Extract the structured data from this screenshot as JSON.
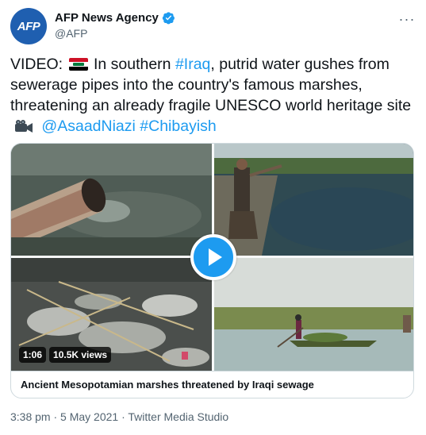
{
  "account": {
    "display_name": "AFP News Agency",
    "handle": "@AFP",
    "avatar_text": "AFP",
    "verified": true,
    "more_glyph": "···"
  },
  "tweet": {
    "lead": "VIDEO:",
    "text_1": "In southern",
    "hashtag_iraq": "#Iraq",
    "text_2": ", putrid water gushes from sewerage pipes into the country's famous marshes, threatening an already fragile UNESCO world heritage site",
    "mention": "@AsaadNiazi",
    "hashtag_chibayish": "#Chibayish"
  },
  "media": {
    "duration": "1:06",
    "views": "10.5K views",
    "caption": "Ancient Mesopotamian marshes threatened by Iraqi sewage"
  },
  "meta": {
    "timestamp": "3:38 pm · 5 May 2021 · Twitter Media Studio"
  },
  "colors": {
    "link": "#1d9bf0",
    "avatar_bg": "#1f5fb0",
    "text": "#0f1419",
    "secondary": "#536471"
  }
}
